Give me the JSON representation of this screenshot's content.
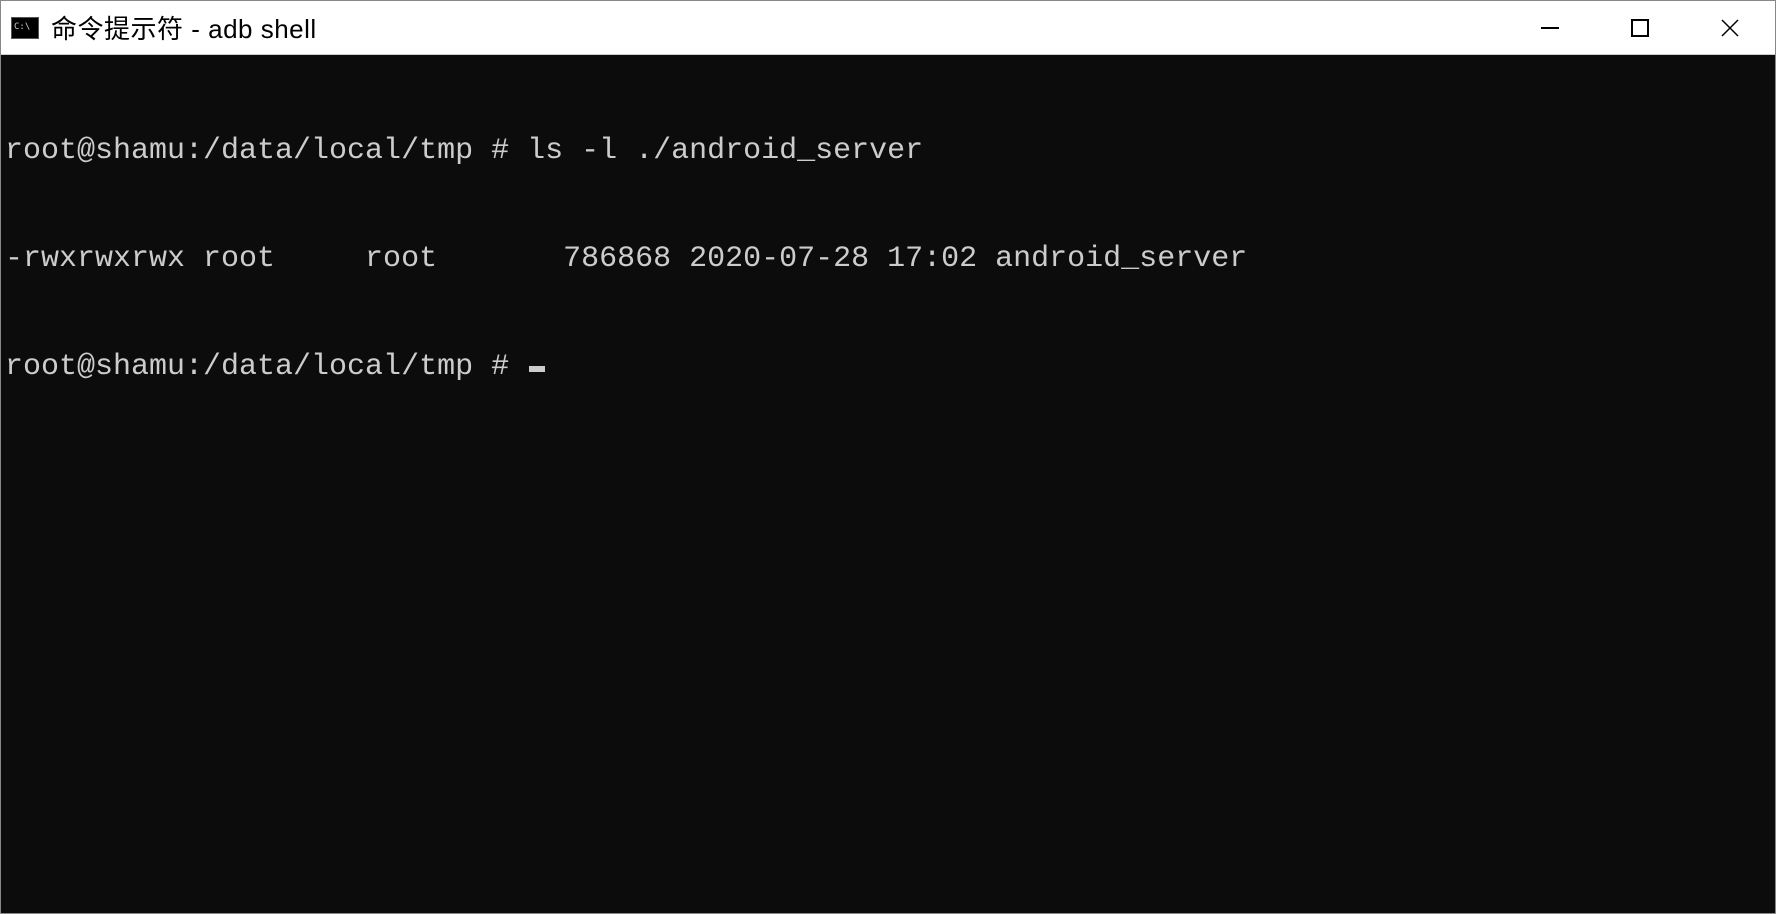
{
  "titlebar": {
    "icon_text": "C:\\",
    "title": "命令提示符 - adb  shell"
  },
  "terminal": {
    "lines": [
      "root@shamu:/data/local/tmp # ls -l ./android_server",
      "-rwxrwxrwx root     root       786868 2020-07-28 17:02 android_server",
      "root@shamu:/data/local/tmp # "
    ]
  }
}
